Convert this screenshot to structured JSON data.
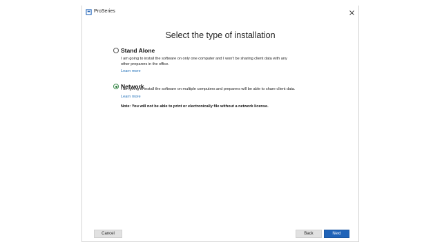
{
  "window": {
    "title": "ProSeries",
    "close_glyph": "×"
  },
  "heading": "Select the type of installation",
  "options": [
    {
      "label": "Stand Alone",
      "selected": false,
      "desc_line1": "I am going to install the software on only one computer and I won't be sharing client data with any",
      "desc_line2": "other preparers in the office.",
      "learn_more": "Learn more"
    },
    {
      "label": "Network",
      "selected": true,
      "desc_line1": "I am going to install the software on multiple computers and preparers will be able to share client data.",
      "learn_more": "Learn more"
    }
  ],
  "note": "Note:  You will not be able to print or electronically file without a network license.",
  "buttons": {
    "cancel": "Cancel",
    "back": "Back",
    "next": "Next"
  },
  "colors": {
    "primary": "#1f63b8",
    "link": "#1f6fb8",
    "radio_selected": "#2f7d3f"
  }
}
